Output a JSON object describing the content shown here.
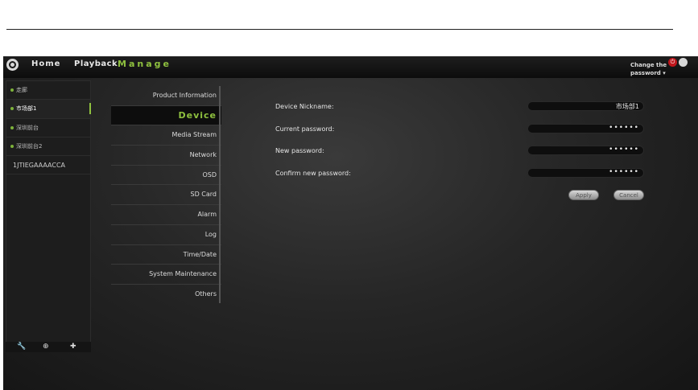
{
  "header": {
    "nav": [
      "Home",
      "Playback",
      "Manage"
    ],
    "change_password_line1": "Change the",
    "change_password_line2": "password",
    "dropdown_glyph": "▾",
    "power_glyph": "⏻"
  },
  "devices": [
    {
      "label": "走廊",
      "online": true
    },
    {
      "label": "市场部1",
      "online": true,
      "selected": true
    },
    {
      "label": "深圳前台",
      "online": true
    },
    {
      "label": "深圳前台2",
      "online": true
    },
    {
      "label": "1JTIEGAAAACCA",
      "online": false
    }
  ],
  "toolbar": {
    "tools": [
      "wrench-icon",
      "zoom-icon",
      "add-icon"
    ],
    "glyphs": [
      "🔧",
      "⊕",
      "✚"
    ]
  },
  "menu": {
    "items": [
      "Product Information",
      "Device",
      "Media Stream",
      "Network",
      "OSD",
      "SD Card",
      "Alarm",
      "Log",
      "Time/Date",
      "System Maintenance",
      "Others"
    ],
    "active": "Device"
  },
  "form": {
    "nickname_label": "Device Nickname:",
    "nickname_value": "市场部1",
    "current_password_label": "Current password:",
    "current_password_value": "••••••",
    "new_password_label": "New password:",
    "new_password_value": "••••••",
    "confirm_password_label": "Confirm new password:",
    "confirm_password_value": "••••••",
    "apply_label": "Apply",
    "cancel_label": "Cancel"
  },
  "colors": {
    "accent": "#8fc13f",
    "background": "#262626",
    "power": "#c0161c"
  }
}
